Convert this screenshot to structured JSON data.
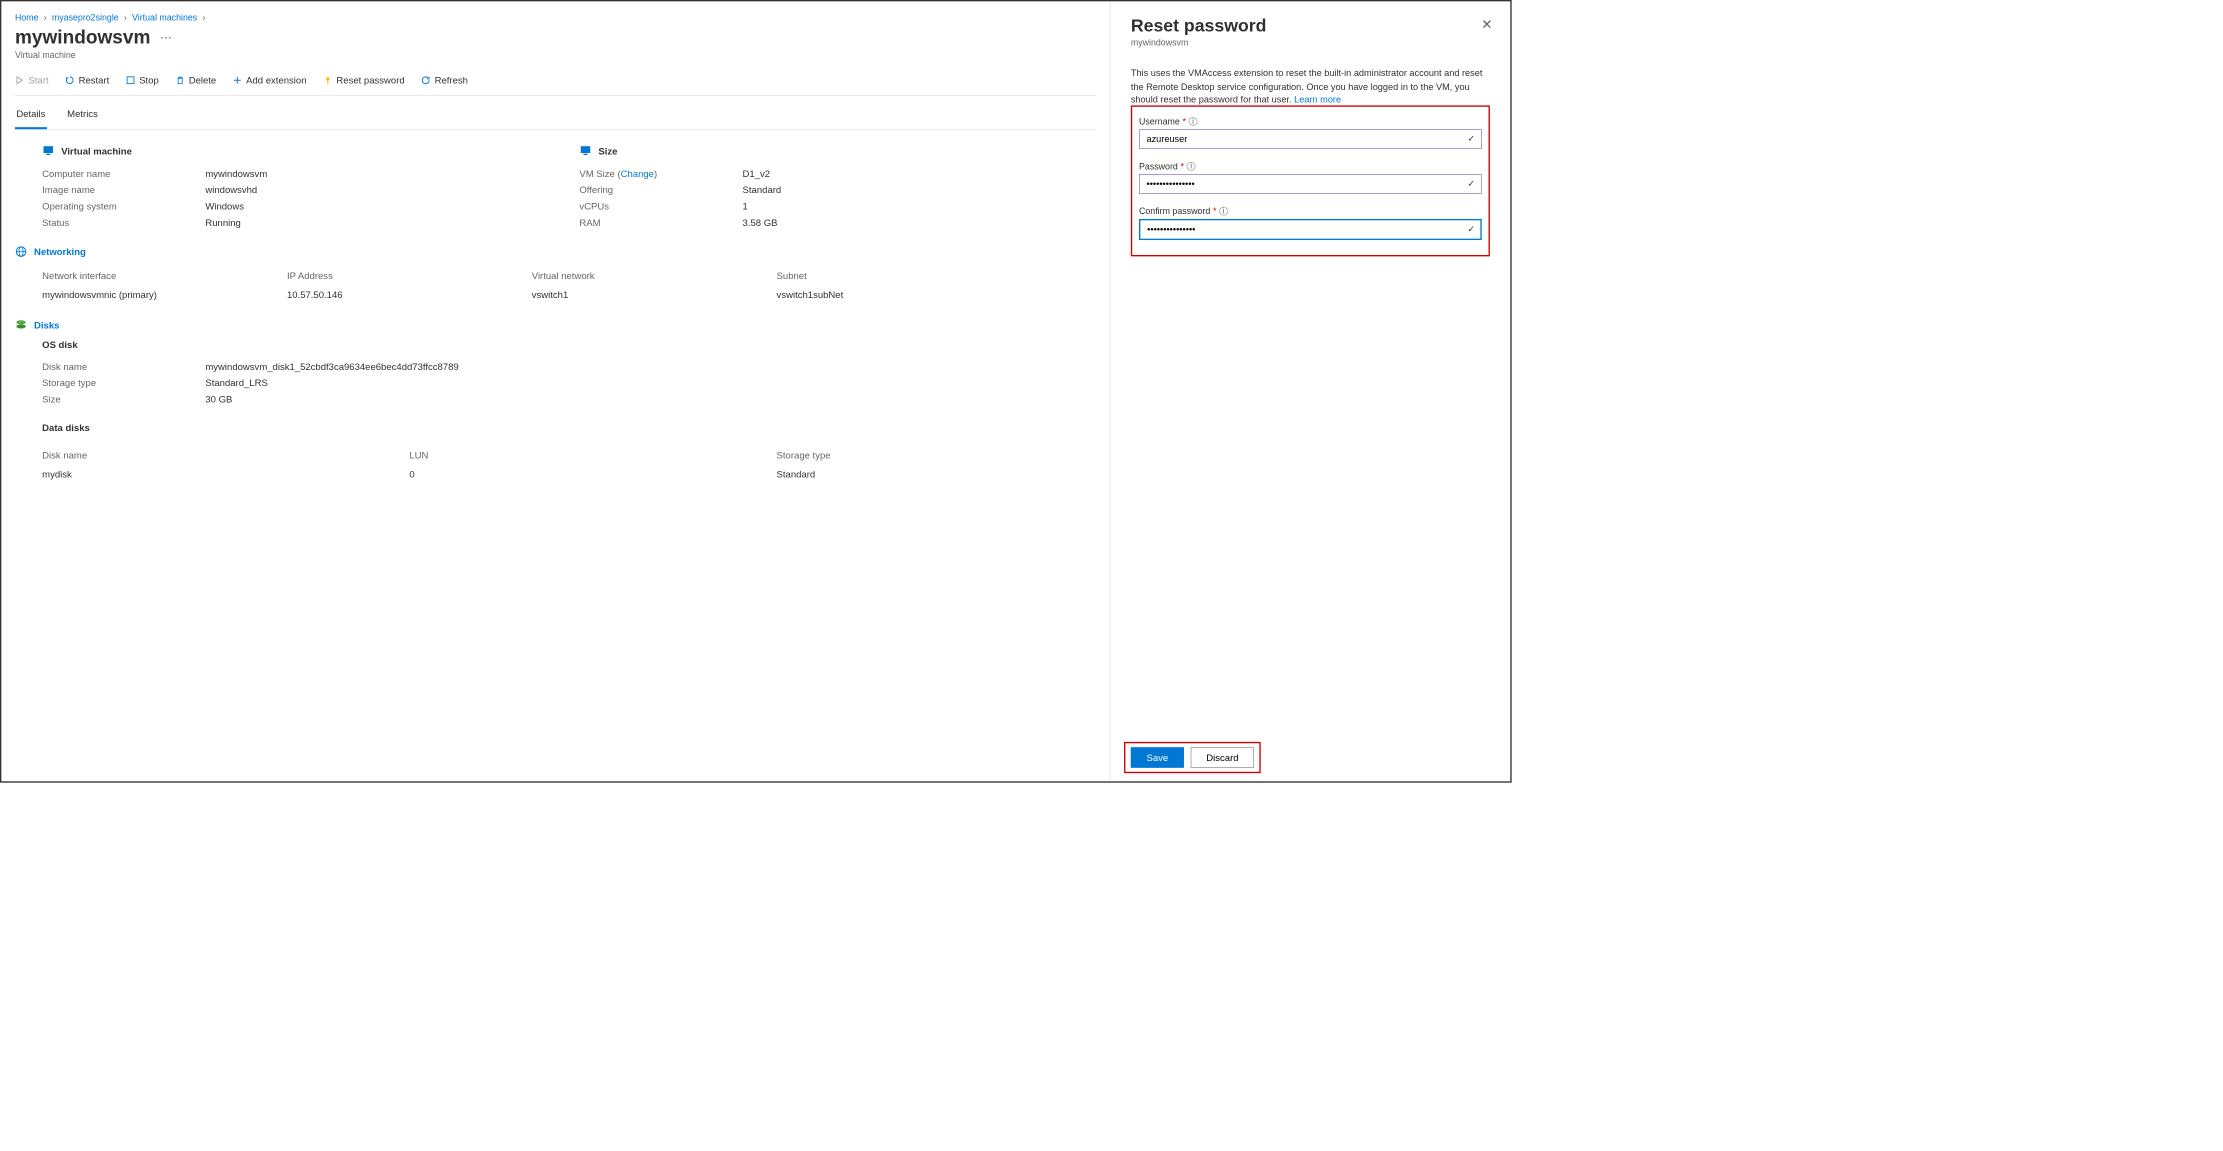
{
  "breadcrumb": {
    "home": "Home",
    "resource": "myasepro2single",
    "service": "Virtual machines"
  },
  "page": {
    "title": "mywindowsvm",
    "subtitle": "Virtual machine"
  },
  "toolbar": {
    "start": "Start",
    "restart": "Restart",
    "stop": "Stop",
    "delete": "Delete",
    "add_extension": "Add extension",
    "reset_password": "Reset password",
    "refresh": "Refresh"
  },
  "tabs": {
    "details": "Details",
    "metrics": "Metrics"
  },
  "vm_section": {
    "title": "Virtual machine",
    "computer_name_label": "Computer name",
    "computer_name": "mywindowsvm",
    "image_name_label": "Image name",
    "image_name": "windowsvhd",
    "os_label": "Operating system",
    "os": "Windows",
    "status_label": "Status",
    "status": "Running"
  },
  "size_section": {
    "title": "Size",
    "vmsize_label": "VM Size",
    "change": "Change",
    "vmsize": "D1_v2",
    "offering_label": "Offering",
    "offering": "Standard",
    "vcpus_label": "vCPUs",
    "vcpus": "1",
    "ram_label": "RAM",
    "ram": "3.58 GB"
  },
  "net_section": {
    "title": "Networking",
    "headers": {
      "nic": "Network interface",
      "ip": "IP Address",
      "vnet": "Virtual network",
      "subnet": "Subnet"
    },
    "row": {
      "nic": "mywindowsvmnic (primary)",
      "ip": "10.57.50.146",
      "vnet": "vswitch1",
      "subnet": "vswitch1subNet"
    }
  },
  "disks_section": {
    "title": "Disks",
    "os_disk": "OS disk",
    "disk_name_label": "Disk name",
    "disk_name": "mywindowsvm_disk1_52cbdf3ca9634ee6bec4dd73ffcc8789",
    "storage_type_label": "Storage type",
    "storage_type": "Standard_LRS",
    "size_label": "Size",
    "size": "30 GB",
    "data_disks": "Data disks",
    "data_headers": {
      "name": "Disk name",
      "lun": "LUN",
      "storage": "Storage type"
    },
    "data_row": {
      "name": "mydisk",
      "lun": "0",
      "storage": "Standard"
    }
  },
  "panel": {
    "title": "Reset password",
    "subtitle": "mywindowsvm",
    "description": "This uses the VMAccess extension to reset the built-in administrator account and reset the Remote Desktop service configuration. Once you have logged in to the VM, you should reset the password for that user.",
    "learn_more": "Learn more",
    "username_label": "Username",
    "username": "azureuser",
    "password_label": "Password",
    "password": "•••••••••••••••",
    "confirm_label": "Confirm password",
    "confirm": "•••••••••••••••",
    "save": "Save",
    "discard": "Discard"
  }
}
